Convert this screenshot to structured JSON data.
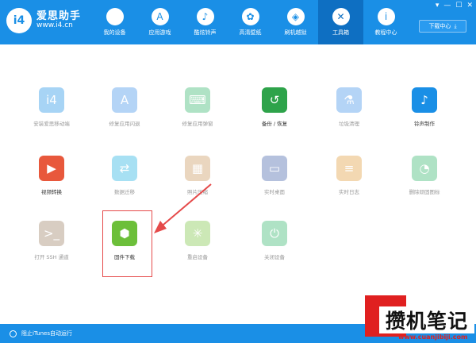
{
  "app": {
    "logo_badge": "i4",
    "name": "爱思助手",
    "url": "www.i4.cn"
  },
  "nav": [
    {
      "label": "我的设备",
      "icon": "apple-icon",
      "glyph": ""
    },
    {
      "label": "应用游戏",
      "icon": "app-store-icon",
      "glyph": "A"
    },
    {
      "label": "酷炫铃声",
      "icon": "bell-icon",
      "glyph": "♪"
    },
    {
      "label": "高清壁纸",
      "icon": "flower-icon",
      "glyph": "✿"
    },
    {
      "label": "刷机越狱",
      "icon": "dropbox-icon",
      "glyph": "◈"
    },
    {
      "label": "工具箱",
      "icon": "tools-icon",
      "glyph": "✕",
      "active": true
    },
    {
      "label": "教程中心",
      "icon": "info-icon",
      "glyph": "i"
    }
  ],
  "window": {
    "controls": [
      "▾",
      "—",
      "☐",
      "✕"
    ]
  },
  "download_center": "下载中心",
  "tools": [
    {
      "label": "安装爱思移动端",
      "icon": "i4-app-icon",
      "glyph": "i4",
      "color": "#1a8fe6",
      "enabled": false
    },
    {
      "label": "修复应用闪退",
      "icon": "app-store-icon",
      "glyph": "A",
      "color": "#3d8fe8",
      "enabled": false
    },
    {
      "label": "修复应用弹窗",
      "icon": "keyboard-icon",
      "glyph": "⌨",
      "color": "#2fb56a",
      "enabled": false
    },
    {
      "label": "备份 / 恢复",
      "icon": "backup-clock-icon",
      "glyph": "↺",
      "color": "#2ea34a",
      "enabled": true
    },
    {
      "label": "垃圾清理",
      "icon": "broom-icon",
      "glyph": "⚗",
      "color": "#3d8fe8",
      "enabled": false
    },
    {
      "label": "铃声制作",
      "icon": "bell-plus-icon",
      "glyph": "♪",
      "color": "#1a8fe6",
      "enabled": true
    },
    {
      "label": "视频转换",
      "icon": "video-play-icon",
      "glyph": "▶",
      "color": "#e8583c",
      "enabled": true
    },
    {
      "label": "数据迁移",
      "icon": "data-transfer-icon",
      "glyph": "⇄",
      "color": "#1ab0e0",
      "enabled": false
    },
    {
      "label": "照片压缩",
      "icon": "photo-icon",
      "glyph": "▦",
      "color": "#c9955a",
      "enabled": false
    },
    {
      "label": "实时桌面",
      "icon": "monitor-icon",
      "glyph": "▭",
      "color": "#3f5ea8",
      "enabled": false
    },
    {
      "label": "实时日志",
      "icon": "log-icon",
      "glyph": "≡",
      "color": "#e09a38",
      "enabled": false
    },
    {
      "label": "删除顽固图标",
      "icon": "pie-icon",
      "glyph": "◔",
      "color": "#2fb56a",
      "enabled": false
    },
    {
      "label": "打开 SSH 通道",
      "icon": "terminal-icon",
      "glyph": ">_",
      "color": "#9b7d62",
      "enabled": false
    },
    {
      "label": "固件下载",
      "icon": "firmware-box-icon",
      "glyph": "⬢",
      "color": "#6cbf3a",
      "enabled": true
    },
    {
      "label": "重启设备",
      "icon": "restart-icon",
      "glyph": "✳",
      "color": "#7cc441",
      "enabled": false
    },
    {
      "label": "关闭设备",
      "icon": "power-icon",
      "glyph": "⏻",
      "color": "#2fb56a",
      "enabled": false
    }
  ],
  "footer": {
    "label": "阻止iTunes自动运行"
  },
  "watermark": {
    "text": "攒机笔记",
    "url": "www.cuanjibiji.com"
  }
}
